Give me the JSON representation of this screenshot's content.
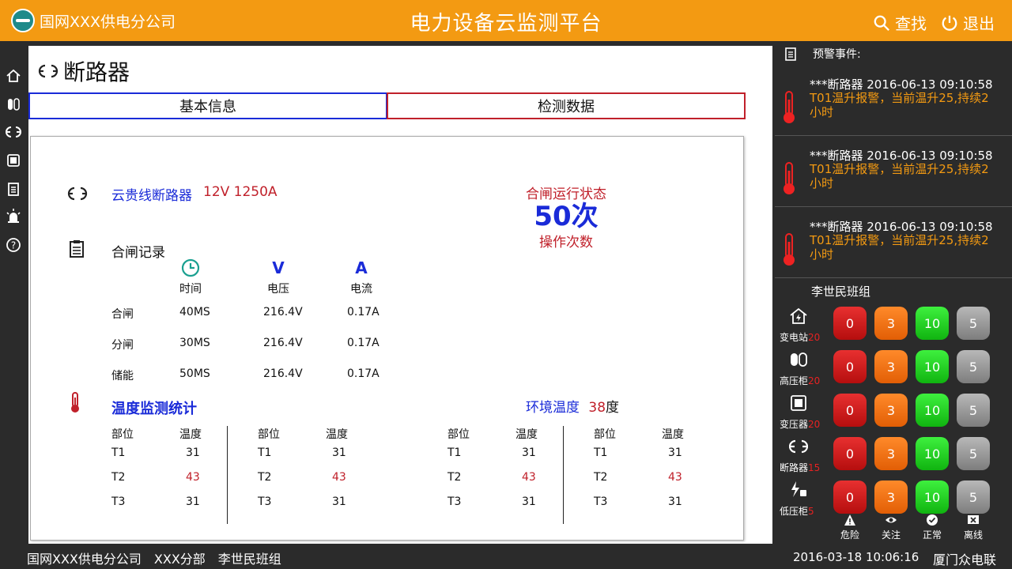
{
  "header": {
    "company": "国网XXX供电分公司",
    "title": "电力设备云监测平台",
    "search_label": "查找",
    "logout_label": "退出"
  },
  "page": {
    "title": "断路器",
    "tabs": [
      {
        "label": "基本信息"
      },
      {
        "label": "检测数据"
      }
    ]
  },
  "device": {
    "name": "云贵线断路器",
    "spec": "12V  1250A",
    "status_label": "合闸运行状态",
    "op_count": "50次",
    "op_label": "操作次数"
  },
  "records": {
    "title": "合闸记录",
    "icons": [
      "clock-icon",
      "V",
      "A"
    ],
    "headers": [
      "时间",
      "电压",
      "电流"
    ],
    "rows": [
      {
        "label": "合闸",
        "time": "40MS",
        "voltage": "216.4V",
        "current": "0.17A"
      },
      {
        "label": "分闸",
        "time": "30MS",
        "voltage": "216.4V",
        "current": "0.17A"
      },
      {
        "label": "储能",
        "time": "50MS",
        "voltage": "216.4V",
        "current": "0.17A"
      }
    ]
  },
  "temperature": {
    "title": "温度监测统计",
    "ambient_label": "环境温度",
    "ambient_value": "38",
    "ambient_unit": "度",
    "col_part": "部位",
    "col_temp": "温度",
    "groups": [
      {
        "rows": [
          {
            "part": "T1",
            "temp": "31"
          },
          {
            "part": "T2",
            "temp": "43"
          },
          {
            "part": "T3",
            "temp": "31"
          }
        ]
      },
      {
        "rows": [
          {
            "part": "T1",
            "temp": "31"
          },
          {
            "part": "T2",
            "temp": "43"
          },
          {
            "part": "T3",
            "temp": "31"
          }
        ]
      },
      {
        "rows": [
          {
            "part": "T1",
            "temp": "31"
          },
          {
            "part": "T2",
            "temp": "43"
          },
          {
            "part": "T3",
            "temp": "31"
          }
        ]
      },
      {
        "rows": [
          {
            "part": "T1",
            "temp": "31"
          },
          {
            "part": "T2",
            "temp": "43"
          },
          {
            "part": "T3",
            "temp": "31"
          }
        ]
      }
    ],
    "highlight_color": "#c0202a"
  },
  "alerts": {
    "header": "预警事件:",
    "items": [
      {
        "title": "***断路器 2016-06-13 09:10:58",
        "message": "T01温升报警，当前温升25,持续2小时"
      },
      {
        "title": "***断路器 2016-06-13 09:10:58",
        "message": "T01温升报警，当前温升25,持续2小时"
      },
      {
        "title": "***断路器 2016-06-13 09:10:58",
        "message": "T01温升报警，当前温升25,持续2小时"
      }
    ]
  },
  "team": {
    "name": "李世民班组",
    "rows": [
      {
        "label": "变电站",
        "count": "20",
        "danger": "0",
        "attention": "3",
        "normal": "10",
        "offline": "5"
      },
      {
        "label": "高压柜",
        "count": "20",
        "danger": "0",
        "attention": "3",
        "normal": "10",
        "offline": "5"
      },
      {
        "label": "变压器",
        "count": "20",
        "danger": "0",
        "attention": "3",
        "normal": "10",
        "offline": "5"
      },
      {
        "label": "断路器",
        "count": "15",
        "danger": "0",
        "attention": "3",
        "normal": "10",
        "offline": "5"
      },
      {
        "label": "低压柜",
        "count": "5",
        "danger": "0",
        "attention": "3",
        "normal": "10",
        "offline": "5"
      }
    ],
    "legend": [
      "危险",
      "关注",
      "正常",
      "离线"
    ]
  },
  "footer": {
    "company": "国网XXX供电分公司",
    "branch": "XXX分部",
    "team": "李世民班组",
    "time": "2016-03-18  10:06:16",
    "brand": "厦门众电联"
  },
  "colors": {
    "header_bg": "#f39a12",
    "accent_blue": "#1a2bd8",
    "accent_red": "#c0202a",
    "alert_text": "#f39a12",
    "danger": "#d61e1e",
    "attention": "#f26a10",
    "normal": "#22d022",
    "offline": "#9a9a9a"
  }
}
